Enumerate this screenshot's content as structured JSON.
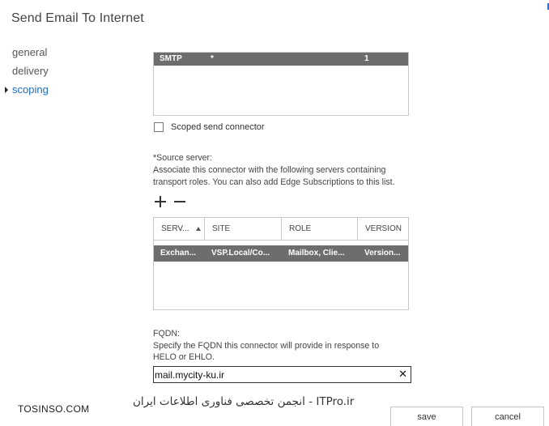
{
  "header": {
    "title": "Send Email To Internet"
  },
  "nav": {
    "items": [
      {
        "label": "general"
      },
      {
        "label": "delivery"
      },
      {
        "label": "scoping"
      }
    ]
  },
  "address_space": {
    "rows": [
      {
        "type": "SMTP",
        "domain": "*",
        "cost": "1"
      }
    ]
  },
  "scoped_connector": {
    "label": "Scoped send connector",
    "checked": false
  },
  "source_server": {
    "label": "*Source server:",
    "description_line1": "Associate this connector with the following servers containing",
    "description_line2": "transport roles. You can also add Edge Subscriptions to this list.",
    "columns": {
      "server": "SERV...",
      "site": "SITE",
      "role": "ROLE",
      "version": "VERSION"
    },
    "rows": [
      {
        "server": "Exchan...",
        "site": "VSP.Local/Co...",
        "role": "Mailbox, Clie...",
        "version": "Version..."
      }
    ]
  },
  "fqdn": {
    "label": "FQDN:",
    "description_line1": "Specify the FQDN this connector will provide in response to",
    "description_line2": "HELO or EHLO.",
    "value": "mail.mycity-ku.ir",
    "clear_glyph": "✕"
  },
  "watermark": {
    "left": "TOSINSO.COM",
    "right": "ITPro.ir - انجمن تخصصی فناوری اطلاعات ایران"
  },
  "footer": {
    "save_label": "save",
    "cancel_label": "cancel"
  },
  "colors": {
    "accent": "#1e6fbf",
    "selected_row": "#6d6d6d",
    "border": "#c8c8c8"
  }
}
